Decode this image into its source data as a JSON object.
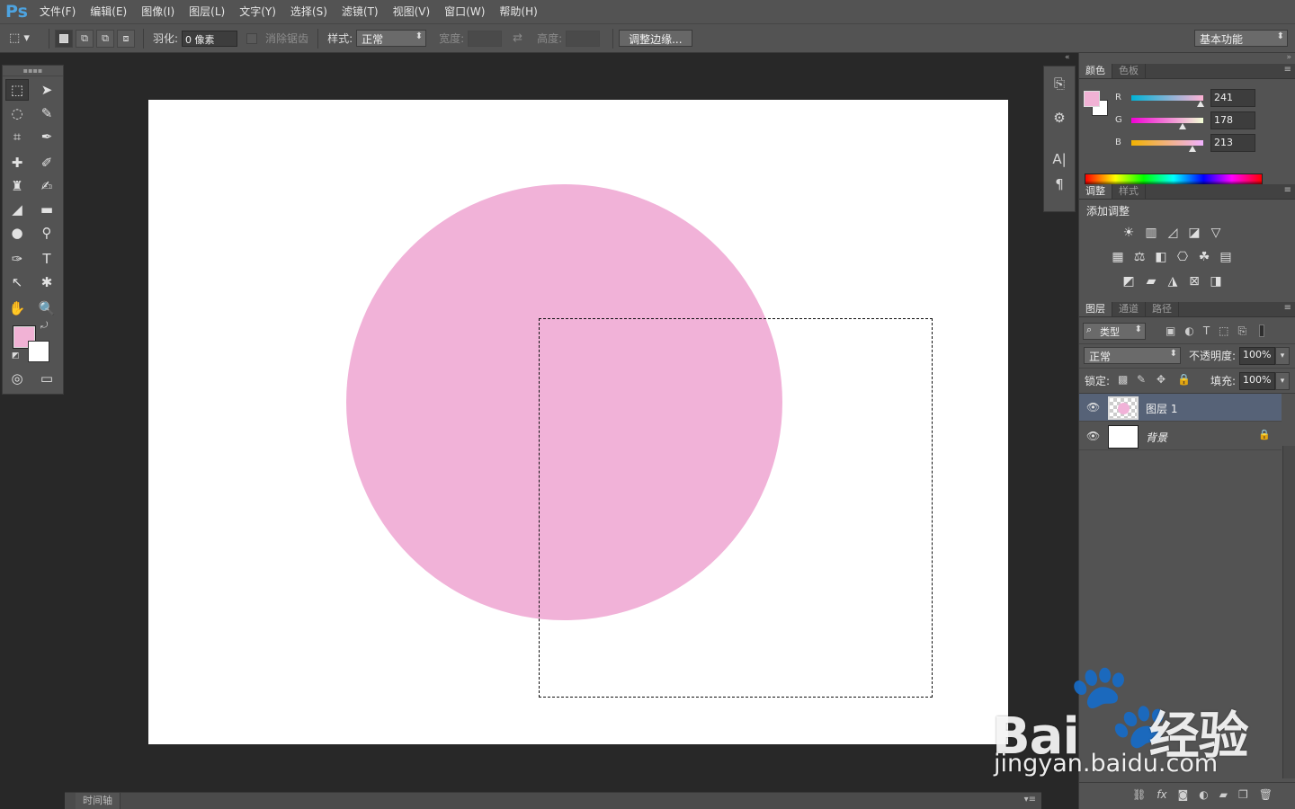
{
  "app": {
    "logo": "Ps"
  },
  "menu": [
    "文件(F)",
    "编辑(E)",
    "图像(I)",
    "图层(L)",
    "文字(Y)",
    "选择(S)",
    "滤镜(T)",
    "视图(V)",
    "窗口(W)",
    "帮助(H)"
  ],
  "options": {
    "feather_label": "羽化:",
    "feather_value": "0 像素",
    "antialias_label": "消除锯齿",
    "style_label": "样式:",
    "style_value": "正常",
    "width_label": "宽度:",
    "height_label": "高度:",
    "refine_edge": "调整边缘...",
    "workspace": "基本功能"
  },
  "colors": {
    "foreground": "#f1b2d5",
    "background": "#ffffff",
    "circle": "#f1b2d8",
    "layer_selected": "#566277"
  },
  "color_panel": {
    "tabs": [
      "颜色",
      "色板"
    ],
    "r_label": "R",
    "r_value": "241",
    "g_label": "G",
    "g_value": "178",
    "b_label": "B",
    "b_value": "213"
  },
  "adjust_panel": {
    "tabs": [
      "调整",
      "样式"
    ],
    "title": "添加调整"
  },
  "layers_panel": {
    "tabs": [
      "图层",
      "通道",
      "路径"
    ],
    "filter_kind": "类型",
    "blend_mode": "正常",
    "opacity_label": "不透明度:",
    "opacity_value": "100%",
    "lock_label": "锁定:",
    "fill_label": "填充:",
    "fill_value": "100%",
    "layers": [
      {
        "name": "图层 1",
        "selected": true
      },
      {
        "name": "背景",
        "selected": false,
        "locked": true
      }
    ]
  },
  "timeline": {
    "tab": "时间轴"
  },
  "watermark": {
    "brand": "Bai",
    "brand2": "经验",
    "url": "jingyan.baidu.com"
  },
  "icons": {
    "eye": "eye-icon",
    "lock": "lock-icon",
    "link": "link-icon",
    "fx": "fx-icon",
    "mask": "mask-icon",
    "new_layer": "new-layer-icon",
    "trash": "trash-icon"
  }
}
